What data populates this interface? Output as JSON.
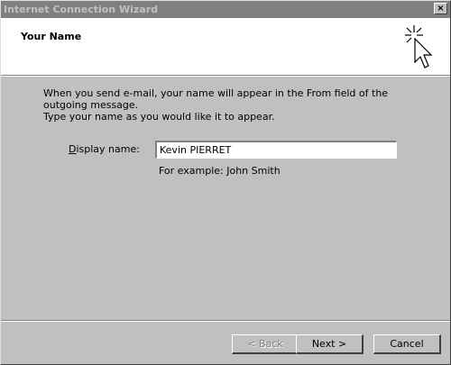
{
  "window": {
    "title": "Internet Connection Wizard",
    "close_glyph": "×"
  },
  "header": {
    "heading": "Your Name",
    "icon": "wizard-cursor-icon"
  },
  "main": {
    "description_line1": "When you send e-mail, your name will appear in the From field of the outgoing message.",
    "description_line2": "Type your name as you would like it to appear.",
    "display_name_accesskey": "D",
    "display_name_label_rest": "isplay name:",
    "display_name_value": "Kevin PIERRET",
    "example_text": "For example: John Smith"
  },
  "footer": {
    "back_label": "< Back",
    "next_label": "Next >",
    "cancel_label": "Cancel",
    "back_enabled": false
  }
}
